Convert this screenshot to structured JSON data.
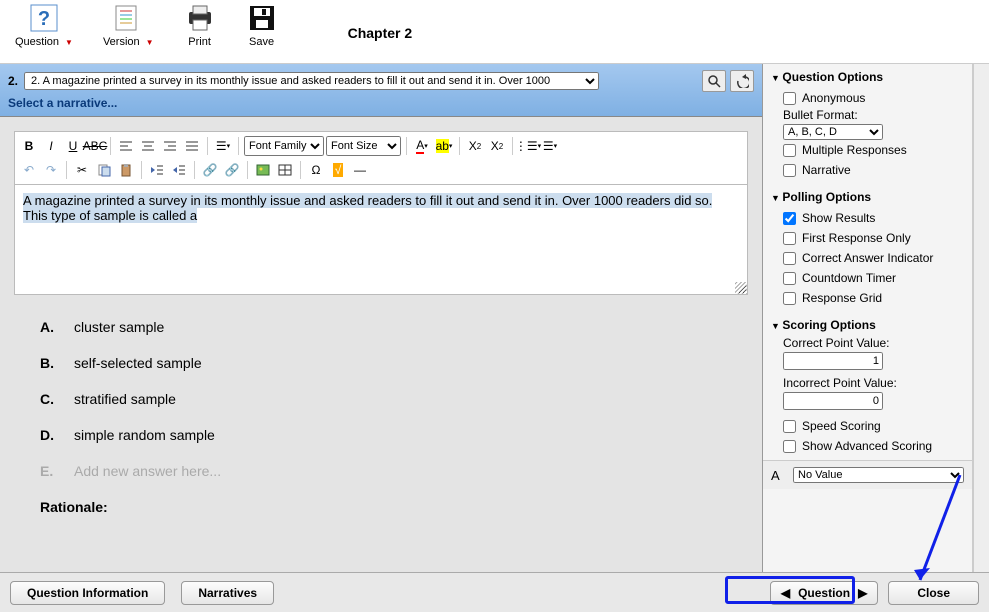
{
  "toolbar": {
    "question": "Question",
    "version": "Version",
    "print": "Print",
    "save": "Save"
  },
  "chapter_title": "Chapter 2",
  "question": {
    "number": "2.",
    "dropdown_text": "2. A magazine printed a survey in its monthly issue and asked readers to fill it out and send it in. Over 1000",
    "narrative_link": "Select a narrative...",
    "body_text": "A magazine printed a survey in its monthly issue and asked readers to fill it out and send it in. Over 1000 readers did so. This type of sample is called a"
  },
  "editor": {
    "font_family_label": "Font Family",
    "font_size_label": "Font Size"
  },
  "answers": [
    {
      "letter": "A.",
      "text": "cluster sample"
    },
    {
      "letter": "B.",
      "text": "self-selected sample"
    },
    {
      "letter": "C.",
      "text": "stratified sample"
    },
    {
      "letter": "D.",
      "text": "simple random sample"
    },
    {
      "letter": "E.",
      "text": "Add new answer here..."
    }
  ],
  "rationale_label": "Rationale:",
  "right_panel": {
    "question_options": {
      "title": "Question Options",
      "anonymous": "Anonymous",
      "bullet_format_label": "Bullet Format:",
      "bullet_format_value": "A, B, C, D",
      "multiple_responses": "Multiple Responses",
      "narrative": "Narrative"
    },
    "polling_options": {
      "title": "Polling Options",
      "show_results": "Show Results",
      "first_response": "First Response Only",
      "correct_indicator": "Correct Answer Indicator",
      "countdown": "Countdown Timer",
      "response_grid": "Response Grid"
    },
    "scoring_options": {
      "title": "Scoring Options",
      "correct_label": "Correct Point Value:",
      "correct_value": "1",
      "incorrect_label": "Incorrect Point Value:",
      "incorrect_value": "0",
      "speed_scoring": "Speed Scoring",
      "show_advanced": "Show Advanced Scoring"
    },
    "value_row": {
      "letter": "A",
      "value": "No Value"
    }
  },
  "bottom": {
    "question_info": "Question Information",
    "narratives": "Narratives",
    "question_nav": "Question",
    "close": "Close"
  }
}
